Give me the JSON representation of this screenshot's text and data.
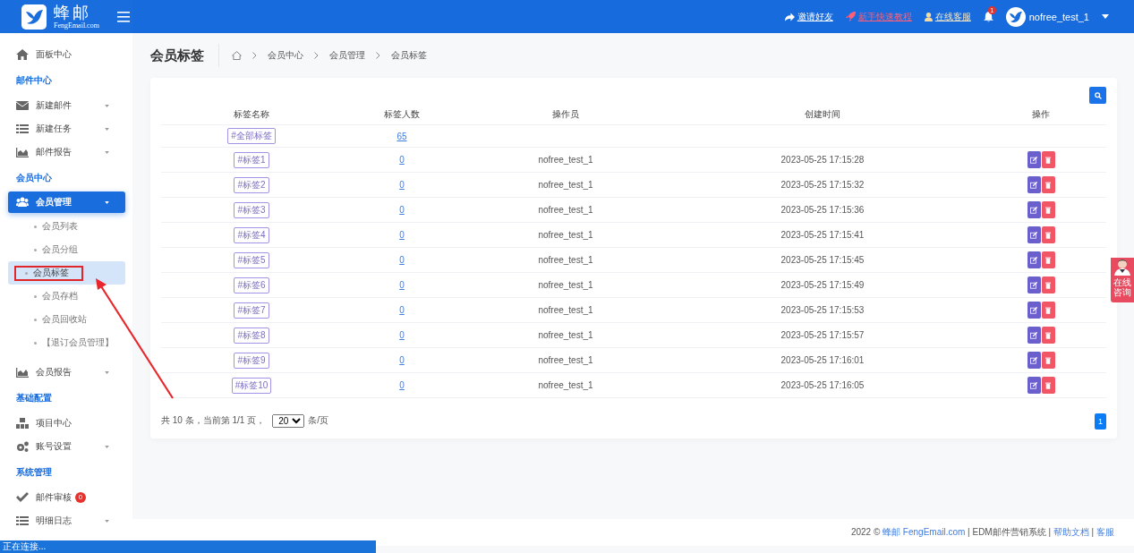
{
  "header": {
    "brand": "蜂邮",
    "brand_sub": "FengEmail.com",
    "links": [
      {
        "label": "邀请好友",
        "kind": "invite"
      },
      {
        "label": "新手快速教程",
        "kind": "guide"
      },
      {
        "label": "在线客服",
        "kind": "service"
      }
    ],
    "notification_count": "1",
    "user": "nofree_test_1"
  },
  "sidebar": [
    {
      "kind": "link",
      "label": "面板中心",
      "selected": false
    },
    {
      "kind": "section",
      "label": "邮件中心"
    },
    {
      "kind": "menu",
      "label": "新建邮件",
      "selected": false
    },
    {
      "kind": "menu",
      "label": "新建任务",
      "selected": false
    },
    {
      "kind": "menu",
      "label": "邮件报告",
      "selected": false
    },
    {
      "kind": "section",
      "label": "会员中心"
    },
    {
      "kind": "menu",
      "label": "会员管理",
      "selected": true
    },
    {
      "kind": "sub",
      "label": "会员列表",
      "selected": false
    },
    {
      "kind": "sub",
      "label": "会员分组",
      "selected": false
    },
    {
      "kind": "sub",
      "label": "会员标签",
      "selected": true
    },
    {
      "kind": "sub",
      "label": "会员存档",
      "selected": false
    },
    {
      "kind": "sub",
      "label": "会员回收站",
      "selected": false
    },
    {
      "kind": "sub",
      "label": "【退订会员管理】",
      "selected": false
    },
    {
      "kind": "menu",
      "label": "会员报告",
      "selected": false
    },
    {
      "kind": "section",
      "label": "基础配置"
    },
    {
      "kind": "link",
      "label": "项目中心",
      "selected": false
    },
    {
      "kind": "menu",
      "label": "账号设置",
      "selected": false
    },
    {
      "kind": "section",
      "label": "系统管理"
    },
    {
      "kind": "link",
      "label": "邮件审核",
      "selected": false,
      "badge": "0"
    },
    {
      "kind": "menu",
      "label": "明细日志",
      "selected": false
    }
  ],
  "page_title": "会员标签",
  "breadcrumb": [
    "会员中心",
    "会员管理",
    "会员标签"
  ],
  "table": {
    "columns": [
      "标签名称",
      "标签人数",
      "操作员",
      "创建时间",
      "操作"
    ],
    "rows": [
      {
        "tag": "#全部标签",
        "count": "65"
      },
      {
        "tag": "#标签1",
        "count": "0",
        "operator": "nofree_test_1",
        "created": "2023-05-25 17:15:28"
      },
      {
        "tag": "#标签2",
        "count": "0",
        "operator": "nofree_test_1",
        "created": "2023-05-25 17:15:32"
      },
      {
        "tag": "#标签3",
        "count": "0",
        "operator": "nofree_test_1",
        "created": "2023-05-25 17:15:36"
      },
      {
        "tag": "#标签4",
        "count": "0",
        "operator": "nofree_test_1",
        "created": "2023-05-25 17:15:41"
      },
      {
        "tag": "#标签5",
        "count": "0",
        "operator": "nofree_test_1",
        "created": "2023-05-25 17:15:45"
      },
      {
        "tag": "#标签6",
        "count": "0",
        "operator": "nofree_test_1",
        "created": "2023-05-25 17:15:49"
      },
      {
        "tag": "#标签7",
        "count": "0",
        "operator": "nofree_test_1",
        "created": "2023-05-25 17:15:53"
      },
      {
        "tag": "#标签8",
        "count": "0",
        "operator": "nofree_test_1",
        "created": "2023-05-25 17:15:57"
      },
      {
        "tag": "#标签9",
        "count": "0",
        "operator": "nofree_test_1",
        "created": "2023-05-25 17:16:01"
      },
      {
        "tag": "#标签10",
        "count": "0",
        "operator": "nofree_test_1",
        "created": "2023-05-25 17:16:05"
      }
    ]
  },
  "pagination": {
    "summary": "共 10 条，当前第 1/1 页，",
    "page_size": "20",
    "unit": "条/页",
    "pages": [
      {
        "label": "1",
        "selected": true
      }
    ]
  },
  "footer": {
    "prefix": "2022 ©",
    "brand_link": "蜂邮 FengEmail.com",
    "separator": "|",
    "system": "EDM邮件营销系统",
    "help_link": "帮助文档",
    "service_link": "客服"
  },
  "consult_widget": "在线咨询",
  "status_bar": "正在连接..."
}
